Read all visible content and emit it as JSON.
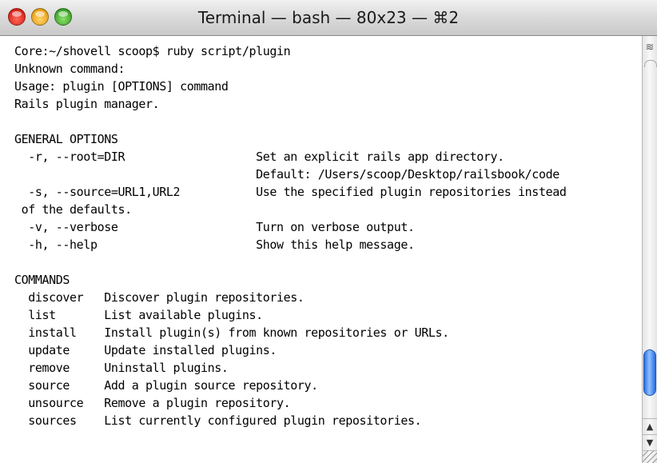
{
  "window": {
    "title": "Terminal — bash — 80x23 — ⌘2"
  },
  "terminal": {
    "lines": [
      "Core:~/shovell scoop$ ruby script/plugin",
      "Unknown command:",
      "Usage: plugin [OPTIONS] command",
      "Rails plugin manager.",
      "",
      "GENERAL OPTIONS",
      "  -r, --root=DIR                   Set an explicit rails app directory.",
      "                                   Default: /Users/scoop/Desktop/railsbook/code",
      "  -s, --source=URL1,URL2           Use the specified plugin repositories instead",
      " of the defaults.",
      "  -v, --verbose                    Turn on verbose output.",
      "  -h, --help                       Show this help message.",
      "",
      "COMMANDS",
      "  discover   Discover plugin repositories.",
      "  list       List available plugins.",
      "  install    Install plugin(s) from known repositories or URLs.",
      "  update     Update installed plugins.",
      "  remove     Uninstall plugins.",
      "  source     Add a plugin source repository.",
      "  unsource   Remove a plugin repository.",
      "  sources    List currently configured plugin repositories."
    ]
  },
  "icons": {
    "close": "close-button-icon",
    "minimize": "minimize-button-icon",
    "zoom": "zoom-button-icon",
    "scroll_up": "arrow-up-icon",
    "scroll_down": "arrow-down-icon",
    "resize": "resize-grip-icon"
  },
  "colors": {
    "close": "#d8241a",
    "minimize": "#e9a21a",
    "zoom": "#3fa32a",
    "scroll_thumb": "#2a6de0"
  }
}
